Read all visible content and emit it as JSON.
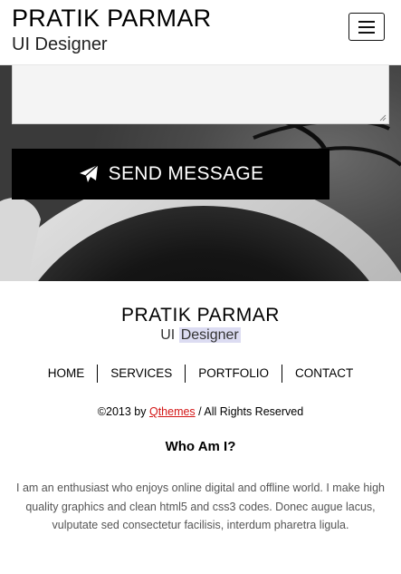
{
  "header": {
    "name": "PRATIK PARMAR",
    "role": "UI Designer",
    "menu_icon": "hamburger-menu-icon"
  },
  "contact": {
    "send_label": "SEND MESSAGE",
    "send_icon": "paper-plane-icon"
  },
  "footer": {
    "name": "PRATIK PARMAR",
    "role_prefix": "UI",
    "role_highlight": "Designer",
    "nav": [
      "HOME",
      "SERVICES",
      "PORTFOLIO",
      "CONTACT"
    ],
    "copyright_prefix": "©2013 by ",
    "copyright_link": "Qthemes",
    "copyright_suffix": " / All Rights Reserved",
    "about_title": "Who Am I?",
    "about_text": "I am an enthusiast who enjoys online digital and offline world. I make high quality graphics and clean html5 and css3 codes. Donec augue lacus, vulputate sed consectetur facilisis, interdum pharetra ligula."
  },
  "colors": {
    "accent_link": "#d31616",
    "button_bg": "#000000",
    "highlight": "#dcdcf2"
  }
}
